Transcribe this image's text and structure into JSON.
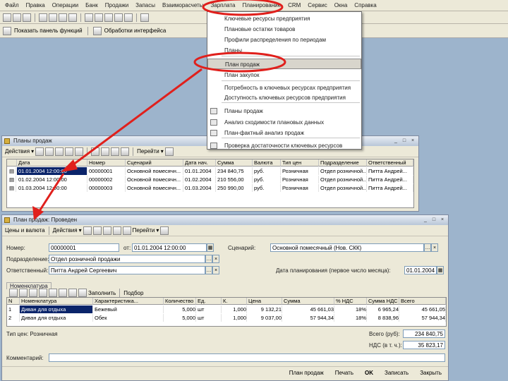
{
  "menubar": [
    "Файл",
    "Правка",
    "Операции",
    "Банк",
    "Продажи",
    "Запасы",
    "Взаиморасчеты",
    "Зарплата",
    "Планирование",
    "CRM",
    "Сервис",
    "Окна",
    "Справка"
  ],
  "toolbar2": {
    "item1": "Показать панель функций",
    "item2": "Обработки интерфейса"
  },
  "dropdown": {
    "items": [
      "Ключевые ресурсы предприятия",
      "Плановые остатки товаров",
      "Профили распределения по периодам",
      "Планы",
      "План продаж",
      "План закупок",
      "Потребность в ключевых ресурсах предприятия",
      "Доступность ключевых ресурсов предприятия",
      "Планы продаж",
      "Анализ сходимости плановых данных",
      "План-фактный анализ продаж",
      "Проверка достаточности ключевых ресурсов"
    ],
    "highlighted_index": 4
  },
  "win1": {
    "title": "Планы продаж",
    "actions": "Действия",
    "toolbar_right": "Перейти",
    "columns": [
      "Дата",
      "Номер",
      "Сценарий",
      "Дата нач.",
      "Сумма",
      "Валюта",
      "Тип цен",
      "Подразделение",
      "Ответственный"
    ],
    "rows": [
      [
        "01.01.2004 12:00:00",
        "00000001",
        "Основной помесячн...",
        "01.01.2004",
        "234 840,75",
        "руб.",
        "Розничная",
        "Отдел розничной...",
        "Питта Андрей..."
      ],
      [
        "01.02.2004 12:00:00",
        "00000002",
        "Основной помесячн...",
        "01.02.2004",
        "210 556,00",
        "руб.",
        "Розничная",
        "Отдел розничной...",
        "Питта Андрей..."
      ],
      [
        "01.03.2004 12:00:00",
        "00000003",
        "Основной помесячн...",
        "01.03.2004",
        "250 990,00",
        "руб.",
        "Розничная",
        "Отдел розничной...",
        "Питта Андрей..."
      ]
    ]
  },
  "win2": {
    "title": "План продаж: Проведен",
    "toolbar": [
      "Цены и валюта",
      "Действия",
      "Перейти"
    ],
    "labels": {
      "number": "Номер:",
      "from": "от:",
      "scenario": "Сценарий:",
      "division": "Подразделение:",
      "responsible": "Ответственный:",
      "period_start": "Дата планирования (первое число месяца):"
    },
    "values": {
      "number": "00000001",
      "date": "01.01.2004 12:00:00",
      "scenario": "Основной помесячный (Нов. СКК)",
      "division": "Отдел розничной продажи",
      "responsible": "Питта Андрей Сергеевич",
      "period_start": "01.01.2004"
    },
    "tab": "Номенклатура",
    "grid_toolbar": [
      "Заполнить",
      "Подбор"
    ],
    "columns": [
      "N",
      "Номенклатура",
      "Характеристика...",
      "Количество",
      "Ед.",
      "К.",
      "Цена",
      "Сумма",
      "% НДС",
      "Сумма НДС",
      "Всего"
    ],
    "rows": [
      [
        "1",
        "Диван для отдыха",
        "Бежевый",
        "5,000",
        "шт",
        "1,000",
        "9 132,21",
        "45 661,03",
        "18%",
        "6 965,24",
        "45 661,05"
      ],
      [
        "2",
        "Диван для отдыха",
        "Обек",
        "5,000",
        "шт",
        "1,000",
        "9 037,00",
        "57 944,34",
        "18%",
        "8 838,96",
        "57 944,34"
      ]
    ],
    "price_type": "Тип цен: Розничная",
    "total_label": "Всего (руб):",
    "total_value": "234 840,75",
    "vat_label": "НДС (в т. ч.):",
    "vat_value": "35 823,17",
    "comment_label": "Комментарий:",
    "bottom": [
      "План продаж",
      "Печать",
      "OK",
      "Записать",
      "Закрыть"
    ]
  },
  "annotation_color": "#e0201c"
}
